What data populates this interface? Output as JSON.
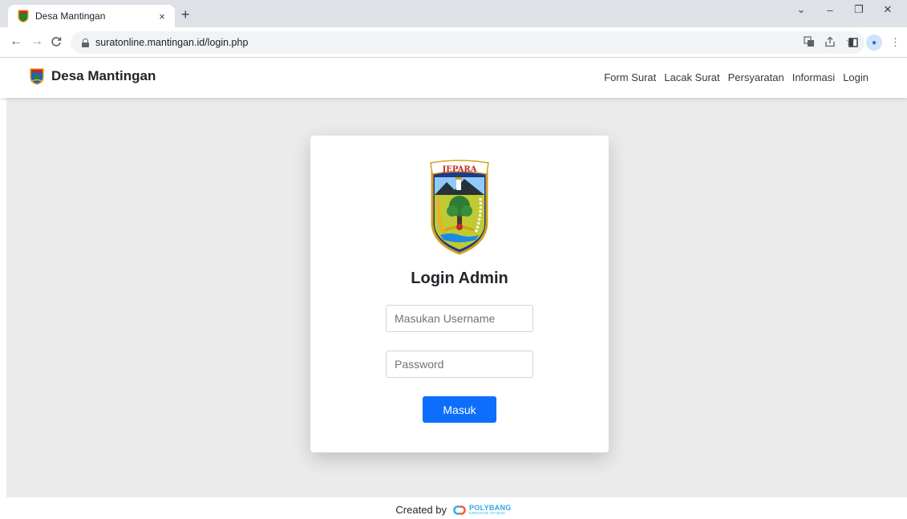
{
  "browser": {
    "tab_title": "Desa Mantingan",
    "tab_close": "×",
    "new_tab": "+",
    "url": "suratonline.mantingan.id/login.php",
    "window_controls": {
      "menu": "⌄",
      "minimize": "–",
      "restore": "❐",
      "close": "✕"
    }
  },
  "navbar": {
    "brand": "Desa Mantingan",
    "links": [
      "Form Surat",
      "Lacak Surat",
      "Persyaratan",
      "Informasi",
      "Login"
    ]
  },
  "login": {
    "emblem_text": "JEPARA",
    "title": "Login Admin",
    "username_placeholder": "Masukan Username",
    "password_placeholder": "Password",
    "submit_label": "Masuk"
  },
  "footer": {
    "text": "Created by",
    "logo_name": "POLYBANG",
    "logo_sub": "CREATIVE STUDIO"
  },
  "colors": {
    "primary": "#0d6efd",
    "background": "#ebebeb",
    "footer_logo": "#29abe2"
  }
}
